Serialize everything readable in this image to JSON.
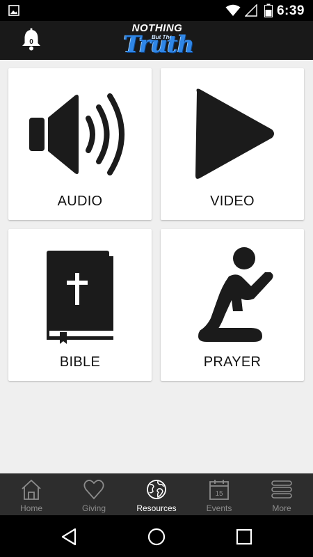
{
  "status_bar": {
    "time": "6:39",
    "icons": [
      "gallery-icon",
      "wifi-icon",
      "signal-icon",
      "battery-icon"
    ]
  },
  "header": {
    "notification_count": "0",
    "logo": {
      "line1": "NOTHING",
      "line2": "But The",
      "line3": "Truth"
    }
  },
  "tiles": [
    {
      "label": "AUDIO",
      "icon": "speaker-icon"
    },
    {
      "label": "VIDEO",
      "icon": "play-icon"
    },
    {
      "label": "BIBLE",
      "icon": "bible-icon"
    },
    {
      "label": "PRAYER",
      "icon": "praying-person-icon"
    }
  ],
  "tabs": [
    {
      "label": "Home",
      "icon": "home-icon",
      "active": false
    },
    {
      "label": "Giving",
      "icon": "heart-icon",
      "active": false
    },
    {
      "label": "Resources",
      "icon": "globe-icon",
      "active": true
    },
    {
      "label": "Events",
      "icon": "calendar-icon",
      "active": false,
      "calendar_day": "15"
    },
    {
      "label": "More",
      "icon": "menu-icon",
      "active": false
    }
  ],
  "navigation": [
    "back-icon",
    "home-circle-icon",
    "recents-icon"
  ],
  "colors": {
    "header_bg": "#191919",
    "content_bg": "#efefef",
    "tabbar_bg": "#2d2d2d",
    "logo_blue": "#2f86e6",
    "active_tab": "#ffffff",
    "inactive_tab": "#8c8c8c"
  }
}
